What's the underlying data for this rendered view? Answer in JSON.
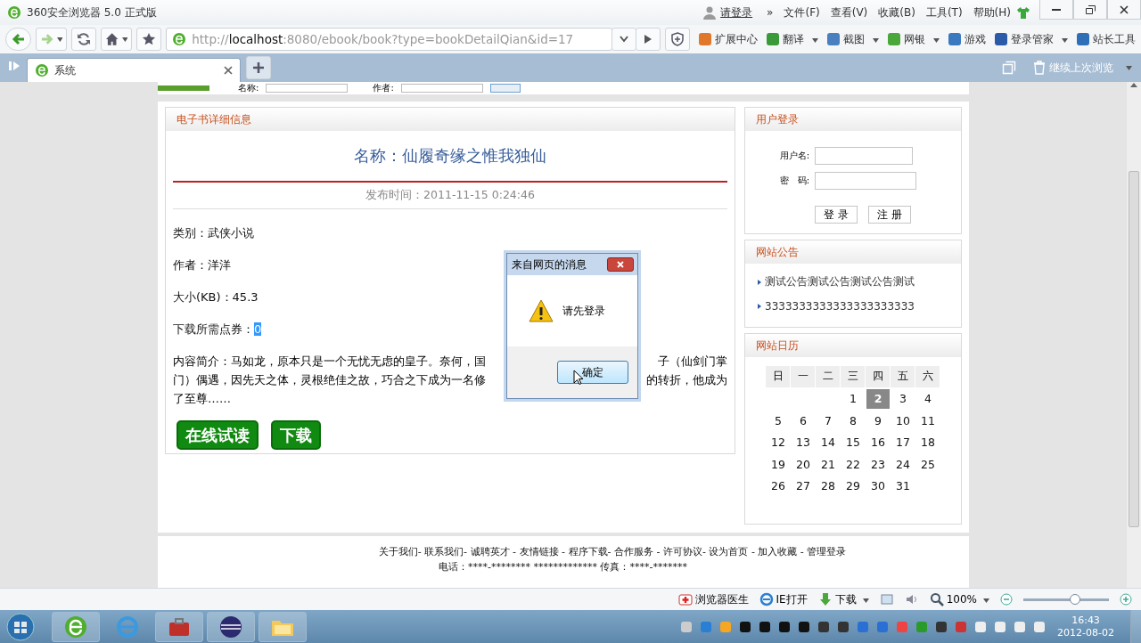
{
  "window": {
    "title": "360安全浏览器 5.0 正式版",
    "login_link": "请登录",
    "chevron": "»",
    "menus": [
      "文件(F)",
      "查看(V)",
      "收藏(B)",
      "工具(T)",
      "帮助(H)"
    ]
  },
  "nav": {
    "url_host": "http://localhost",
    "url_rest": ":8080/ebook/book?type=bookDetailQian&id=17",
    "tools": [
      {
        "label": "扩展中心",
        "dropdown": false
      },
      {
        "label": "翻译",
        "dropdown": true
      },
      {
        "label": "截图",
        "dropdown": true
      },
      {
        "label": "网银",
        "dropdown": true
      },
      {
        "label": "游戏",
        "dropdown": false
      },
      {
        "label": "登录管家",
        "dropdown": true
      },
      {
        "label": "站长工具",
        "dropdown": false
      }
    ]
  },
  "tabs": [
    {
      "label": "系统",
      "selected": true
    }
  ],
  "tabbar": {
    "restore_label": "继续上次浏览"
  },
  "search_strip": {
    "labels": [
      "名称:",
      "作者:"
    ]
  },
  "book": {
    "section_title": "电子书详细信息",
    "name": "名称：仙履奇缘之惟我独仙",
    "published": "发布时间：2011-11-15 0:24:46",
    "fields": [
      {
        "label": "类别：",
        "value": "武侠小说",
        "highlighted": false
      },
      {
        "label": "作者：",
        "value": "洋洋",
        "highlighted": false
      },
      {
        "label": "大小(KB)：",
        "value": "45.3",
        "highlighted": false
      },
      {
        "label": "下载所需点券：",
        "value": "0",
        "highlighted": true
      }
    ],
    "description_lines": [
      {
        "left": "内容简介：马如龙，原本只是一个无忧无虑的皇子。奈何，国",
        "right": "子（仙剑门掌"
      },
      {
        "left": "门）偶遇，因先天之体，灵根绝佳之故，巧合之下成为一名修",
        "right": "的转折，他成为"
      },
      {
        "left": "了至尊……"
      }
    ],
    "buttons": [
      "在线试读",
      "下载"
    ]
  },
  "login": {
    "title": "用户登录",
    "username_label": "用户名:",
    "password_label": "密　码:",
    "buttons": [
      "登 录",
      "注 册"
    ]
  },
  "notices": {
    "title": "网站公告",
    "items": [
      "测试公告测试公告测试公告测试",
      "3333333333333333333333"
    ]
  },
  "calendar": {
    "title": "网站日历",
    "weekdays": [
      "日",
      "一",
      "二",
      "三",
      "四",
      "五",
      "六"
    ],
    "weeks": [
      [
        {
          "kind": "blank"
        },
        {
          "kind": "blank"
        },
        {
          "kind": "blank"
        },
        {
          "kind": "day",
          "day": "1",
          "selected": false
        },
        {
          "kind": "day",
          "day": "2",
          "selected": true
        },
        {
          "kind": "day",
          "day": "3",
          "selected": false
        },
        {
          "kind": "day",
          "day": "4",
          "selected": false
        }
      ],
      [
        {
          "kind": "day",
          "day": "5",
          "selected": false
        },
        {
          "kind": "day",
          "day": "6",
          "selected": false
        },
        {
          "kind": "day",
          "day": "7",
          "selected": false
        },
        {
          "kind": "day",
          "day": "8",
          "selected": false
        },
        {
          "kind": "day",
          "day": "9",
          "selected": false
        },
        {
          "kind": "day",
          "day": "10",
          "selected": false
        },
        {
          "kind": "day",
          "day": "11",
          "selected": false
        }
      ],
      [
        {
          "kind": "day",
          "day": "12",
          "selected": false
        },
        {
          "kind": "day",
          "day": "13",
          "selected": false
        },
        {
          "kind": "day",
          "day": "14",
          "selected": false
        },
        {
          "kind": "day",
          "day": "15",
          "selected": false
        },
        {
          "kind": "day",
          "day": "16",
          "selected": false
        },
        {
          "kind": "day",
          "day": "17",
          "selected": false
        },
        {
          "kind": "day",
          "day": "18",
          "selected": false
        }
      ],
      [
        {
          "kind": "day",
          "day": "19",
          "selected": false
        },
        {
          "kind": "day",
          "day": "20",
          "selected": false
        },
        {
          "kind": "day",
          "day": "21",
          "selected": false
        },
        {
          "kind": "day",
          "day": "22",
          "selected": false
        },
        {
          "kind": "day",
          "day": "23",
          "selected": false
        },
        {
          "kind": "day",
          "day": "24",
          "selected": false
        },
        {
          "kind": "day",
          "day": "25",
          "selected": false
        }
      ],
      [
        {
          "kind": "day",
          "day": "26",
          "selected": false
        },
        {
          "kind": "day",
          "day": "27",
          "selected": false
        },
        {
          "kind": "day",
          "day": "28",
          "selected": false
        },
        {
          "kind": "day",
          "day": "29",
          "selected": false
        },
        {
          "kind": "day",
          "day": "30",
          "selected": false
        },
        {
          "kind": "day",
          "day": "31",
          "selected": false
        },
        {
          "kind": "blank"
        }
      ]
    ]
  },
  "footer": {
    "links": "关于我们- 联系我们- 诚聘英才 - 友情链接 - 程序下载- 合作服务 - 许可协议- 设为首页 - 加入收藏 - 管理登录",
    "contact": "电话：****-******** ************* 传真：****-*******"
  },
  "dialog": {
    "title": "来自网页的消息",
    "message": "请先登录",
    "button": "确定"
  },
  "status_bar": {
    "doctor": "浏览器医生",
    "ie": "IE打开",
    "download": "下载",
    "zoom": "100%",
    "zoom_slider": {
      "level": 0.6
    }
  },
  "taskbar": {
    "time": "16:43",
    "date": "2012-08-02"
  }
}
